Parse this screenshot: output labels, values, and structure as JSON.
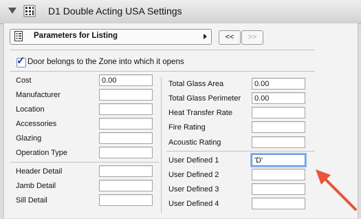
{
  "header": {
    "title": "D1 Double Acting USA Settings",
    "collapse_icon": "disclosure-triangle-icon",
    "settings_icon": "settings-grid-icon"
  },
  "listing_selector": {
    "label": "Parameters for Listing",
    "icon": "list-document-icon",
    "prev_label": "<<",
    "next_label": ">>"
  },
  "zone_checkbox": {
    "label": "Door belongs to the Zone into which it opens",
    "checked": true
  },
  "left_group1": [
    {
      "label": "Cost",
      "value": "0.00"
    },
    {
      "label": "Manufacturer",
      "value": ""
    },
    {
      "label": "Location",
      "value": ""
    },
    {
      "label": "Accessories",
      "value": ""
    },
    {
      "label": "Glazing",
      "value": ""
    },
    {
      "label": "Operation Type",
      "value": ""
    }
  ],
  "left_group2": [
    {
      "label": "Header Detail",
      "value": ""
    },
    {
      "label": "Jamb Detail",
      "value": ""
    },
    {
      "label": "Sill Detail",
      "value": ""
    }
  ],
  "right_group1": [
    {
      "label": "Total Glass Area",
      "value": "0.00"
    },
    {
      "label": "Total Glass Perimeter",
      "value": "0.00"
    },
    {
      "label": "Heat Transfer Rate",
      "value": ""
    },
    {
      "label": "Fire Rating",
      "value": ""
    },
    {
      "label": "Acoustic Rating",
      "value": ""
    }
  ],
  "right_group2": [
    {
      "label": "User Defined 1",
      "value": "'D'"
    },
    {
      "label": "User Defined 2",
      "value": ""
    },
    {
      "label": "User Defined 3",
      "value": ""
    },
    {
      "label": "User Defined 4",
      "value": ""
    }
  ],
  "colors": {
    "annotation_arrow": "#e8533a",
    "focus_ring": "#8bb5ee"
  }
}
